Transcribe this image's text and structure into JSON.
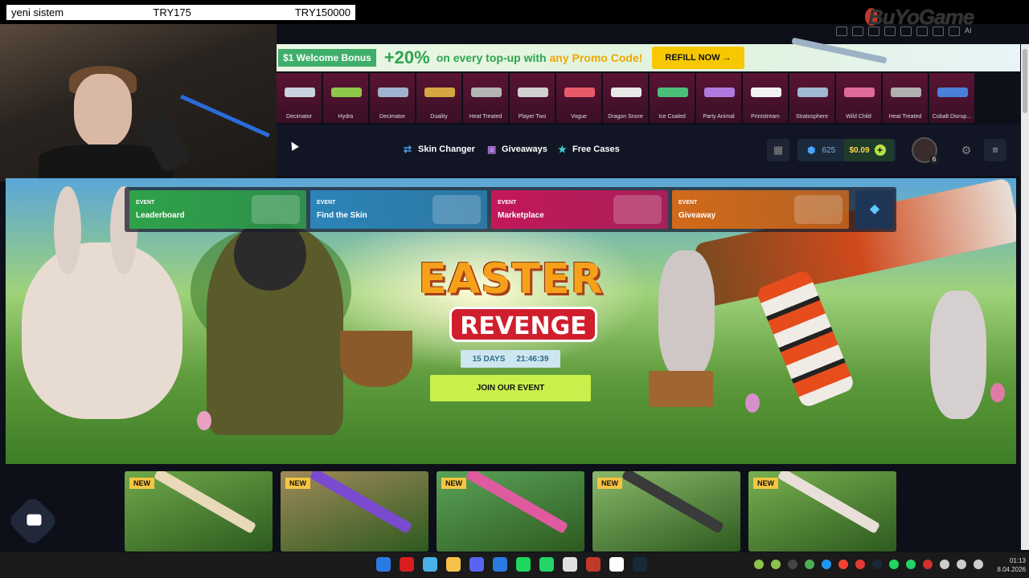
{
  "stream_overlay": {
    "name": "yeni sistem",
    "amount_a": "TRY175",
    "amount_b": "TRY150000"
  },
  "brand": "BuYoGame",
  "browser_icons": [
    "edit-icon",
    "camera-icon",
    "extension-icon",
    "refresh-icon",
    "play-icon",
    "share-icon",
    "download-icon",
    "menu-icon"
  ],
  "browser_ai_label": "AI",
  "promo": {
    "badge": "$1 Welcome Bonus",
    "percent": "+20%",
    "text_main": "on every top-up with",
    "text_highlight": "any Promo Code!",
    "button": "REFILL NOW →"
  },
  "drops": [
    {
      "name": "Decimator",
      "color": "#c9d3e0"
    },
    {
      "name": "Hydra",
      "color": "#8fc74a"
    },
    {
      "name": "Decimator",
      "color": "#9fb3d0"
    },
    {
      "name": "Duality",
      "color": "#d6a640"
    },
    {
      "name": "Heat Treated",
      "color": "#b5b5b5"
    },
    {
      "name": "Player Two",
      "color": "#d0d0d0"
    },
    {
      "name": "Vogue",
      "color": "#e85a6a"
    },
    {
      "name": "Dragon Snore",
      "color": "#e8e8e8"
    },
    {
      "name": "Ice Coaled",
      "color": "#4bbf7a"
    },
    {
      "name": "Party Animal",
      "color": "#b07be0"
    },
    {
      "name": "Printstream",
      "color": "#f2f2f2"
    },
    {
      "name": "Stratosphere",
      "color": "#a0b8d0"
    },
    {
      "name": "Wild Child",
      "color": "#e06a9a"
    },
    {
      "name": "Heat Treated",
      "color": "#b0b0b0"
    },
    {
      "name": "Cobalt Disrup...",
      "color": "#4a80d8"
    }
  ],
  "nav": {
    "skin_changer": "Skin Changer",
    "giveaways": "Giveaways",
    "free_cases": "Free Cases",
    "gems": "625",
    "balance": "$0.09",
    "avatar_badge": "6"
  },
  "events": [
    {
      "tag": "EVENT",
      "name": "Leaderboard",
      "bg": "#2fa24a"
    },
    {
      "tag": "EVENT",
      "name": "Find the Skin",
      "bg": "#2c84b8"
    },
    {
      "tag": "EVENT",
      "name": "Marketplace",
      "bg": "#c4175a"
    },
    {
      "tag": "EVENT",
      "name": "Giveaway",
      "bg": "#d36a19"
    }
  ],
  "hero": {
    "title_line1": "EASTER",
    "title_line2": "REVENGE",
    "timer_days": "15 DAYS",
    "timer_time": "21:46:39",
    "join_button": "JOIN OUR EVENT"
  },
  "new_cards": [
    {
      "badge": "NEW",
      "bg": "#6fa84a",
      "blade": "#e8d9b8"
    },
    {
      "badge": "NEW",
      "bg": "#a08a5a",
      "blade": "#7a4ad0"
    },
    {
      "badge": "NEW",
      "bg": "#5aa35a",
      "blade": "#e05aa0"
    },
    {
      "badge": "NEW",
      "bg": "#8ab86a",
      "blade": "#3a3a3a"
    },
    {
      "badge": "NEW",
      "bg": "#78b050",
      "blade": "#e8e0d8"
    }
  ],
  "taskbar_apps": [
    "#2a7ae2",
    "#d81e1e",
    "#4ab0e8",
    "#f4c24a",
    "#5865f2",
    "#2a7ae2",
    "#1ed760",
    "#25d366",
    "#e0e0e0",
    "#c0392b",
    "#ffffff",
    "#1b2838"
  ],
  "tray_icons": [
    "#8bc34a",
    "#8bc34a",
    "#444",
    "#4caf50",
    "#2196f3",
    "#f44336",
    "#e53935",
    "#1b2838",
    "#1ed760",
    "#25d366",
    "#d32f2f",
    "#ccc",
    "#ccc",
    "#ccc"
  ],
  "clock": {
    "time": "01:13",
    "date": "8.04.2026"
  }
}
